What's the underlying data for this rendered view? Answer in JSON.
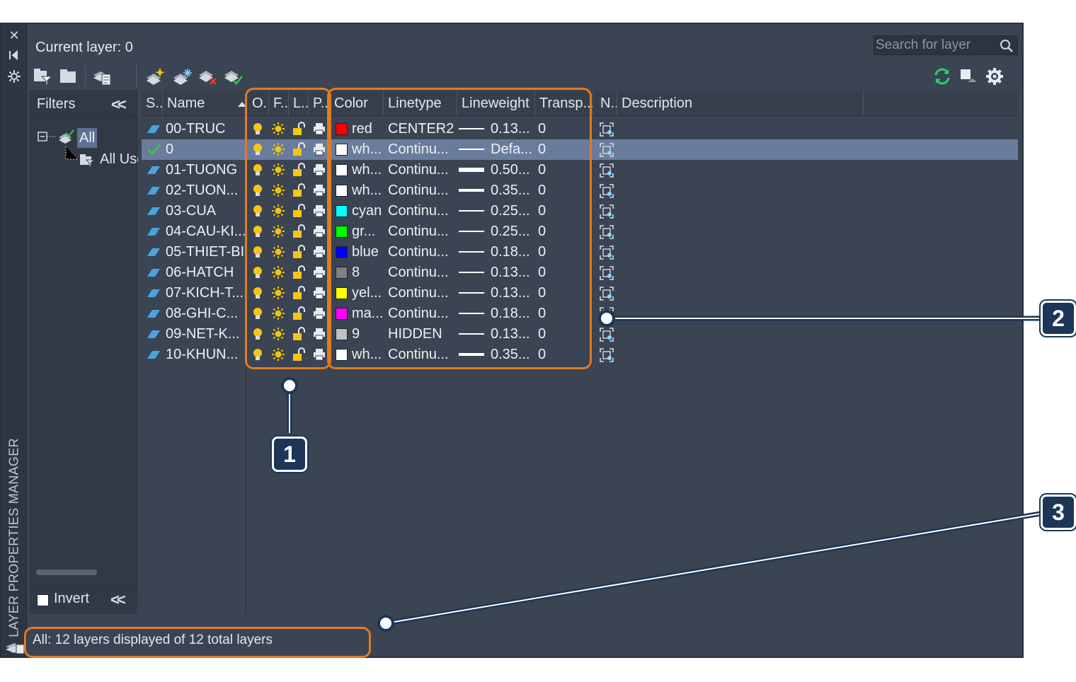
{
  "palette": {
    "title": "LAYER PROPERTIES MANAGER",
    "current_layer": "Current layer: 0",
    "search_placeholder": "Search for layer"
  },
  "filters": {
    "header": "Filters",
    "tree": [
      {
        "label": "All",
        "selected": true
      },
      {
        "label": "All Used Layers"
      }
    ],
    "invert_label": "Invert",
    "invert_checked": false
  },
  "columns": [
    "S..",
    "Name",
    "O..",
    "F..",
    "L..",
    "P..",
    "Color",
    "Linetype",
    "Lineweight",
    "Transp...",
    "N..",
    "Description"
  ],
  "layers": [
    {
      "name": "00-TRUC",
      "current": false,
      "color_name": "red",
      "color_hex": "#ff0000",
      "linetype": "CENTER2",
      "lineweight": "0.13...",
      "line_weight_level": "thin",
      "transparency": "0"
    },
    {
      "name": "0",
      "current": true,
      "color_name": "wh...",
      "color_hex": "#ffffff",
      "linetype": "Continu...",
      "lineweight": "Defa...",
      "line_weight_level": "thin",
      "transparency": "0"
    },
    {
      "name": "01-TUONG",
      "current": false,
      "color_name": "wh...",
      "color_hex": "#ffffff",
      "linetype": "Continu...",
      "lineweight": "0.50...",
      "line_weight_level": "thick",
      "transparency": "0"
    },
    {
      "name": "02-TUON...",
      "current": false,
      "color_name": "wh...",
      "color_hex": "#ffffff",
      "linetype": "Continu...",
      "lineweight": "0.35...",
      "line_weight_level": "medium",
      "transparency": "0"
    },
    {
      "name": "03-CUA",
      "current": false,
      "color_name": "cyan",
      "color_hex": "#00ffff",
      "linetype": "Continu...",
      "lineweight": "0.25...",
      "line_weight_level": "thin",
      "transparency": "0"
    },
    {
      "name": "04-CAU-KI...",
      "current": false,
      "color_name": "gr...",
      "color_hex": "#00ff00",
      "linetype": "Continu...",
      "lineweight": "0.25...",
      "line_weight_level": "thin",
      "transparency": "0"
    },
    {
      "name": "05-THIET-BI",
      "current": false,
      "color_name": "blue",
      "color_hex": "#0000ff",
      "linetype": "Continu...",
      "lineweight": "0.18...",
      "line_weight_level": "thin",
      "transparency": "0"
    },
    {
      "name": "06-HATCH",
      "current": false,
      "color_name": "8",
      "color_hex": "#808080",
      "linetype": "Continu...",
      "lineweight": "0.13...",
      "line_weight_level": "thin",
      "transparency": "0"
    },
    {
      "name": "07-KICH-T...",
      "current": false,
      "color_name": "yel...",
      "color_hex": "#ffff00",
      "linetype": "Continu...",
      "lineweight": "0.13...",
      "line_weight_level": "thin",
      "transparency": "0"
    },
    {
      "name": "08-GHI-C...",
      "current": false,
      "color_name": "ma...",
      "color_hex": "#ff00ff",
      "linetype": "Continu...",
      "lineweight": "0.18...",
      "line_weight_level": "thin",
      "transparency": "0"
    },
    {
      "name": "09-NET-K...",
      "current": false,
      "color_name": "9",
      "color_hex": "#c0c0c0",
      "linetype": "HIDDEN",
      "lineweight": "0.13...",
      "line_weight_level": "thin",
      "transparency": "0"
    },
    {
      "name": "10-KHUN...",
      "current": false,
      "color_name": "wh...",
      "color_hex": "#ffffff",
      "linetype": "Continu...",
      "lineweight": "0.35...",
      "line_weight_level": "medium",
      "transparency": "0"
    }
  ],
  "status": "All: 12 layers displayed of 12 total layers",
  "callouts": [
    "1",
    "2",
    "3"
  ],
  "colors": {
    "panel_bg": "#3b4453",
    "selection": "#6a7c9c",
    "highlight": "#e07b25",
    "callout": "#1d3657",
    "layer_icon": "#4aa3df",
    "current_check": "#3fbf4f",
    "bulb": "#f5c518",
    "refresh": "#2ecc71"
  },
  "icons": {
    "sidebar": [
      "close-icon",
      "auto-hide-icon",
      "properties-icon"
    ],
    "toolbar": [
      "new-property-filter-icon",
      "new-group-filter-icon",
      "layer-states-manager-icon",
      "new-layer-icon",
      "new-layer-vp-frozen-icon",
      "delete-layer-icon",
      "set-current-icon",
      "refresh-icon",
      "layer-merge-icon",
      "settings-icon"
    ]
  }
}
